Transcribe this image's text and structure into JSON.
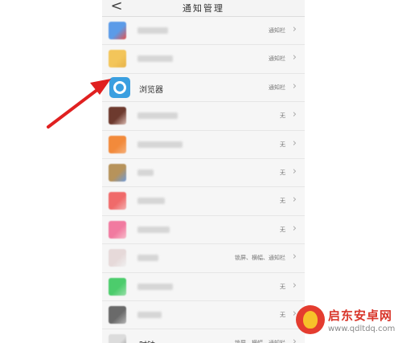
{
  "header": {
    "back_label": "<",
    "title": "通知管理"
  },
  "apps": [
    {
      "name": "",
      "status": "通知栏",
      "icon_color": "#5b9be8",
      "icon_color2": "#e8504a"
    },
    {
      "name": "",
      "status": "通知栏",
      "icon_color": "#f3c55a",
      "icon_color2": "#e7b34a"
    },
    {
      "name": "浏览器",
      "status": "通知栏",
      "icon_color": "#3a9fe0",
      "icon_color2": "#3a9fe0"
    },
    {
      "name": "",
      "status": "无",
      "icon_color": "#6d3a2e",
      "icon_color2": "#d9b9b0"
    },
    {
      "name": "",
      "status": "无",
      "icon_color": "#f28a3b",
      "icon_color2": "#f5b07a"
    },
    {
      "name": "",
      "status": "无",
      "icon_color": "#b7935b",
      "icon_color2": "#6f9bd9"
    },
    {
      "name": "",
      "status": "无",
      "icon_color": "#f06a6a",
      "icon_color2": "#f3b0b0"
    },
    {
      "name": "",
      "status": "无",
      "icon_color": "#f17aa0",
      "icon_color2": "#f7bccb"
    },
    {
      "name": "",
      "status": "锁屏、横幅、通知栏",
      "icon_color": "#e6d9d9",
      "icon_color2": "#f0f0f0"
    },
    {
      "name": "",
      "status": "无",
      "icon_color": "#4ccc6c",
      "icon_color2": "#98dea8"
    },
    {
      "name": "",
      "status": "无",
      "icon_color": "#6a6a6a",
      "icon_color2": "#b5b5b5"
    },
    {
      "name": "时钟",
      "status": "锁屏、横幅、通知栏",
      "icon_color": "#dcdcdc",
      "icon_color2": "#8a8a8a"
    }
  ],
  "watermark": {
    "title": "启东安卓网",
    "url": "www.qdltdq.com"
  },
  "colors": {
    "arrow": "#e02020",
    "browser_icon": "#3a9fe0"
  }
}
